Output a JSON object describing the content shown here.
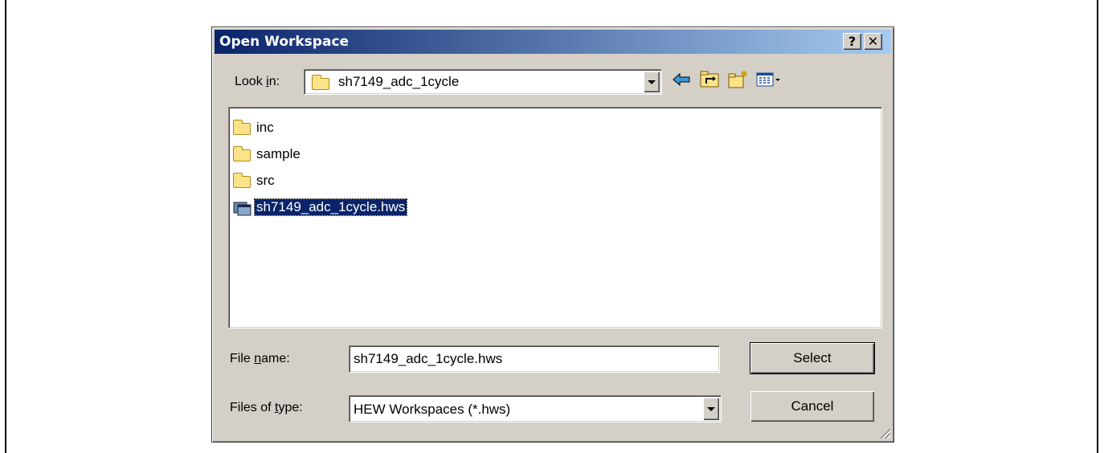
{
  "dialog": {
    "title": "Open Workspace",
    "help_label": "?",
    "close_label": "✕"
  },
  "look_in": {
    "label_prefix": "Look ",
    "label_underlined": "i",
    "label_suffix": "n:",
    "value": "sh7149_adc_1cycle"
  },
  "toolbar": {
    "back_icon": "back-arrow-icon",
    "up_icon": "up-folder-icon",
    "new_folder_icon": "new-folder-icon",
    "view_icon": "view-menu-icon"
  },
  "files": [
    {
      "name": "inc",
      "type": "folder"
    },
    {
      "name": "sample",
      "type": "folder"
    },
    {
      "name": "src",
      "type": "folder"
    },
    {
      "name": "sh7149_adc_1cycle.hws",
      "type": "workspace",
      "selected": true
    }
  ],
  "file_name": {
    "label_prefix": "File ",
    "label_underlined": "n",
    "label_suffix": "ame:",
    "value": "sh7149_adc_1cycle.hws"
  },
  "file_type": {
    "label_prefix": "Files of ",
    "label_underlined": "t",
    "label_suffix": "ype:",
    "value": "HEW Workspaces (*.hws)"
  },
  "buttons": {
    "select": "Select",
    "cancel": "Cancel"
  },
  "colors": {
    "titlebar_start": "#0a246a",
    "titlebar_end": "#a6caf0",
    "dialog_face": "#d4d0c8",
    "selection": "#0a246a"
  }
}
